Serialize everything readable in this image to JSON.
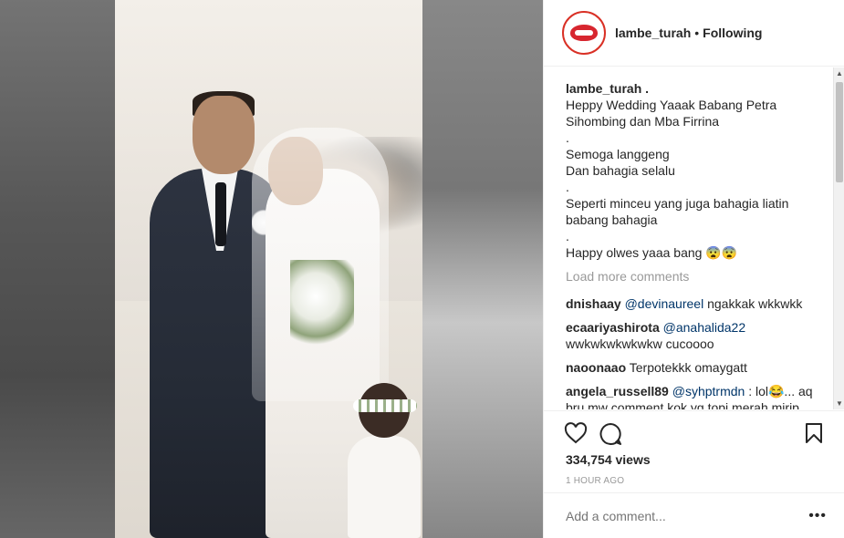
{
  "header": {
    "username": "lambe_turah",
    "separator": "•",
    "follow_status": "Following",
    "avatar_icon": "lips-logo-icon"
  },
  "caption": {
    "username": "lambe_turah .",
    "lines": [
      "Heppy Wedding Yaaak Babang Petra",
      "Sihombing dan Mba Firrina",
      ".",
      "Semoga langgeng",
      "Dan bahagia selalu",
      ".",
      "Seperti minceu yang juga bahagia liatin",
      "babang bahagia",
      ".",
      "Happy olwes yaaa bang 😨😨"
    ]
  },
  "load_more": "Load more comments",
  "comments": [
    {
      "user": "dnishaay",
      "mention": "@devinaureel",
      "text": " ngakkak wkkwkk"
    },
    {
      "user": "ecaariyashirota",
      "mention": "@anahalida22",
      "text": " wwkwkwkwkwkw cucoooo"
    },
    {
      "user": "naoonaao",
      "mention": "",
      "text": " Terpotekkk omaygatt"
    },
    {
      "user": "angela_russell89",
      "mention": "@syhptrmdn",
      "text": " : lol😂... aq bru mw comment kok yg topi merah mirip bang ucild😂😂😂"
    }
  ],
  "actions": {
    "like_icon": "heart-icon",
    "comment_icon": "comment-bubble-icon",
    "save_icon": "bookmark-icon"
  },
  "views": "334,754 views",
  "time": "1 HOUR AGO",
  "add_comment": {
    "placeholder": "Add a comment...",
    "more_label": "•••"
  }
}
